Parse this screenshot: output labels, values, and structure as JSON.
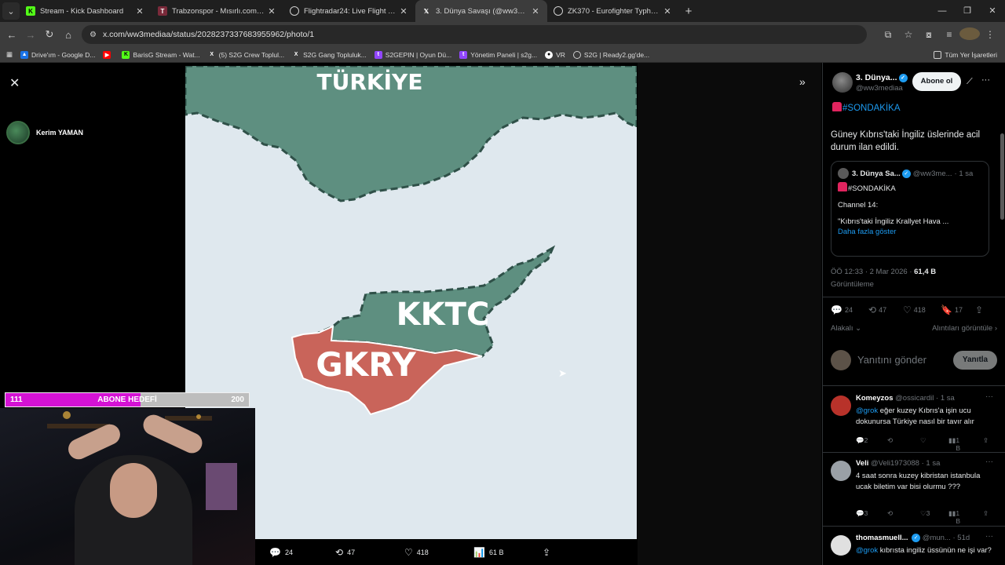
{
  "browser": {
    "tabs": [
      {
        "title": "Stream - Kick Dashboard",
        "icon": "kick-icon",
        "active": false
      },
      {
        "title": "Trabzonspor - Mısırlı.com.tr Fat...",
        "icon": "trabzonspor-icon",
        "active": false
      },
      {
        "title": "Flightradar24: Live Flight Tracke...",
        "icon": "globe-icon",
        "active": false
      },
      {
        "title": "3. Dünya Savaşı (@ww3mediaa)",
        "icon": "x-icon",
        "active": true
      },
      {
        "title": "ZK370 - Eurofighter Typhoon F...",
        "icon": "globe-icon",
        "active": false
      }
    ],
    "url": "x.com/ww3mediaa/status/2028237337683955962/photo/1",
    "bookmarks": [
      {
        "label": "Drive'ım - Google D...",
        "icon": "drive-icon"
      },
      {
        "label": "",
        "icon": "youtube-icon"
      },
      {
        "label": "BarisG Stream - Wat...",
        "icon": "kick-icon"
      },
      {
        "label": "(5) S2G Crew Toplul...",
        "icon": "x-icon"
      },
      {
        "label": "S2G Gang Topluluk...",
        "icon": "x-icon"
      },
      {
        "label": "S2GEPIN | Oyun Dü...",
        "icon": "twitch-icon"
      },
      {
        "label": "Yönetim Paneli | s2g...",
        "icon": "twitch-icon"
      },
      {
        "label": "VR",
        "icon": "github-icon"
      },
      {
        "label": "S2G | Ready2.gg'de...",
        "icon": "globe-icon"
      }
    ],
    "bookmarks_folder": "Tüm Yer İşaretleri"
  },
  "overlay": {
    "streamer_name": "Kerim YAMAN",
    "goal": {
      "current": "111",
      "target": "200",
      "label": "ABONE HEDEFİ",
      "progress": 0.555
    }
  },
  "photo": {
    "labels": {
      "north": "TÜRKİYE",
      "kktc": "KKTC",
      "gkry": "GKRY"
    },
    "actions": {
      "replies": "24",
      "reposts": "47",
      "likes": "418",
      "views": "61 B"
    }
  },
  "tweet": {
    "author_name": "3. Dünya...",
    "author_handle": "@ww3mediaa",
    "follow_label": "Abone ol",
    "hashtag": "#SONDAKİKA",
    "text": "Güney Kıbrıs'taki İngiliz üslerinde acil durum ilan edildi.",
    "quote": {
      "author": "3. Dünya Sa...",
      "handle": "@ww3me...",
      "time": "· 1 sa",
      "hashtag": "#SONDAKİKA",
      "line1": "Channel 14:",
      "line2": "\"Kıbrıs'taki İngiliz Krallyet Hava ...",
      "show_more": "Daha fazla göster"
    },
    "timestamp": "ÖÖ 12:33 · 2 Mar 2026 ·",
    "views": "61,4 B",
    "views_label": "Görüntüleme",
    "stats": {
      "replies": "24",
      "reposts": "47",
      "likes": "418",
      "bookmarks": "17"
    },
    "sort_label": "Alakalı",
    "quotes_link": "Alıntıları görüntüle",
    "reply_placeholder": "Yanıtını gönder",
    "reply_button": "Yanıtla"
  },
  "replies": [
    {
      "name": "Komeyzos",
      "handle": "@ossicardil · 1 sa",
      "mention": "@grok",
      "text": " eğer kuzey Kıbrıs'a işin ucu dokunursa Türkiye nasıl bir tavır alır",
      "replies": "2",
      "reposts": "",
      "likes": "",
      "views": "1 B",
      "avatar_color": "#b8322a"
    },
    {
      "name": "Veli",
      "handle": "@Veli1973088 · 1 sa",
      "mention": "",
      "text": "4 saat sonra kuzey kibristan istanbula ucak biletim var bisi olurmu ???",
      "replies": "3",
      "reposts": "",
      "likes": "3",
      "views": "1 B",
      "avatar_color": "#9aa0a6"
    },
    {
      "name": "thomasmuell...",
      "handle": "@mun... · 51d",
      "mention": "@grok",
      "text": " kıbrısta ingiliz üssünün ne işi var?",
      "replies": "",
      "reposts": "",
      "likes": "",
      "views": "",
      "avatar_color": "#e0e0e0"
    }
  ],
  "colors": {
    "x_blue": "#1d9bf0",
    "goal_fill": "#d412d4",
    "sea": "#dfe8ee",
    "turkey": "#5e8f80",
    "kktc": "#5e8f80",
    "gkry": "#c9645a"
  }
}
